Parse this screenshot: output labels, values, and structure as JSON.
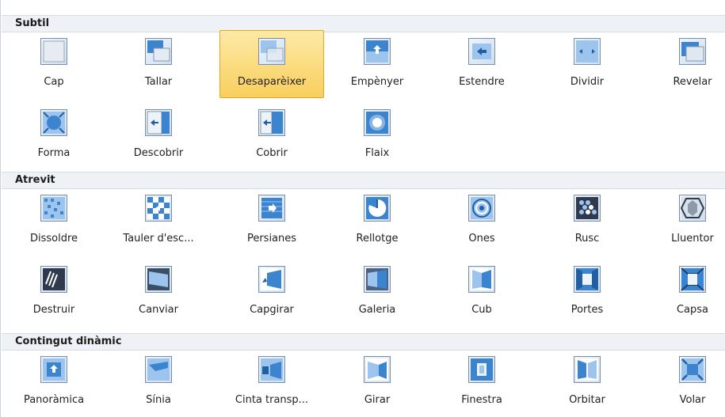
{
  "sections": [
    {
      "title": "Subtil",
      "items": [
        {
          "label": "Cap",
          "icon": "none-transition-icon"
        },
        {
          "label": "Tallar",
          "icon": "cut-transition-icon"
        },
        {
          "label": "Desaparèixer",
          "icon": "fade-transition-icon",
          "selected": true
        },
        {
          "label": "Empènyer",
          "icon": "push-transition-icon"
        },
        {
          "label": "Estendre",
          "icon": "wipe-transition-icon"
        },
        {
          "label": "Dividir",
          "icon": "split-transition-icon"
        },
        {
          "label": "Revelar",
          "icon": "reveal-transition-icon"
        },
        {
          "label": "Forma",
          "icon": "shape-transition-icon"
        },
        {
          "label": "Descobrir",
          "icon": "uncover-transition-icon"
        },
        {
          "label": "Cobrir",
          "icon": "cover-transition-icon"
        },
        {
          "label": "Flaix",
          "icon": "flash-transition-icon"
        }
      ]
    },
    {
      "title": "Atrevit",
      "items": [
        {
          "label": "Dissoldre",
          "icon": "dissolve-transition-icon"
        },
        {
          "label": "Tauler d'esc...",
          "icon": "checkerboard-transition-icon"
        },
        {
          "label": "Persianes",
          "icon": "blinds-transition-icon"
        },
        {
          "label": "Rellotge",
          "icon": "clock-transition-icon"
        },
        {
          "label": "Ones",
          "icon": "ripple-transition-icon"
        },
        {
          "label": "Rusc",
          "icon": "honeycomb-transition-icon"
        },
        {
          "label": "Lluentor",
          "icon": "glitter-transition-icon"
        },
        {
          "label": "Destruir",
          "icon": "shred-transition-icon"
        },
        {
          "label": "Canviar",
          "icon": "switch-transition-icon"
        },
        {
          "label": "Capgirar",
          "icon": "flip-transition-icon"
        },
        {
          "label": "Galeria",
          "icon": "gallery-transition-icon"
        },
        {
          "label": "Cub",
          "icon": "cube-transition-icon"
        },
        {
          "label": "Portes",
          "icon": "doors-transition-icon"
        },
        {
          "label": "Capsa",
          "icon": "box-transition-icon"
        }
      ]
    },
    {
      "title": "Contingut dinàmic",
      "items": [
        {
          "label": "Panoràmica",
          "icon": "pan-transition-icon"
        },
        {
          "label": "Sínia",
          "icon": "ferris-wheel-transition-icon"
        },
        {
          "label": "Cinta transp...",
          "icon": "conveyor-transition-icon"
        },
        {
          "label": "Girar",
          "icon": "rotate-transition-icon"
        },
        {
          "label": "Finestra",
          "icon": "window-transition-icon"
        },
        {
          "label": "Orbitar",
          "icon": "orbit-transition-icon"
        },
        {
          "label": "Volar",
          "icon": "fly-through-transition-icon"
        }
      ]
    }
  ]
}
